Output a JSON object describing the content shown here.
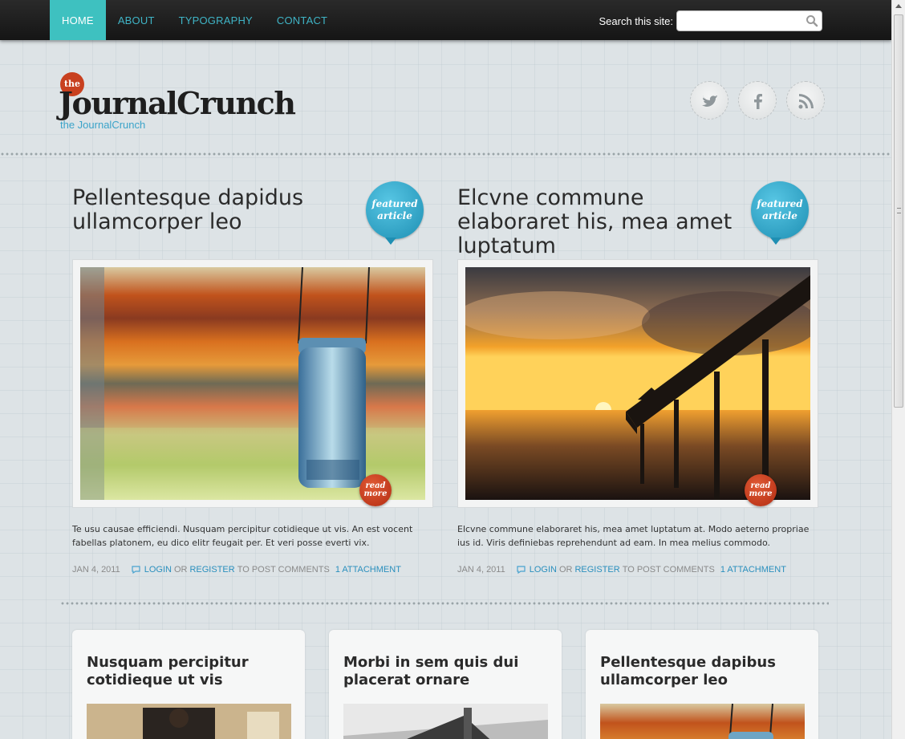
{
  "nav": {
    "items": [
      {
        "label": "HOME",
        "active": true
      },
      {
        "label": "ABOUT"
      },
      {
        "label": "TYPOGRAPHY"
      },
      {
        "label": "CONTACT"
      }
    ],
    "search_label": "Search this site:",
    "search_value": "",
    "search_icon": "magnifier-icon"
  },
  "header": {
    "logo_badge": "the",
    "logo_title": "JournalCrunch",
    "tagline": "the JournalCrunch",
    "social": [
      "twitter-icon",
      "facebook-icon",
      "rss-icon"
    ]
  },
  "featured": [
    {
      "title": "Pellentesque dapidus ullamcorper leo",
      "badge": "featured article",
      "badge_line1": "featured",
      "badge_line2": "article",
      "readmore_line1": "read",
      "readmore_line2": "more",
      "excerpt": "Te usu causae efficiendi. Nusquam percipitur cotidieque ut vis. An est vocent fabellas platonem, eu dico elitr feugait per. Et veri posse everti vix.",
      "date": "JAN 4, 2011",
      "login": "LOGIN",
      "or": "OR",
      "register": "REGISTER",
      "post_comments": "TO POST COMMENTS",
      "attachment": "1 ATTACHMENT"
    },
    {
      "title": "Elcvne commune elaboraret his, mea amet luptatum",
      "badge": "featured article",
      "badge_line1": "featured",
      "badge_line2": "article",
      "readmore_line1": "read",
      "readmore_line2": "more",
      "excerpt": "Elcvne commune elaboraret his, mea amet luptatum at. Modo aeterno propriae ius id. Viris definiebas reprehendunt ad eam. In mea melius commodo.",
      "date": "JAN 4, 2011",
      "login": "LOGIN",
      "or": "OR",
      "register": "REGISTER",
      "post_comments": "TO POST COMMENTS",
      "attachment": "1 ATTACHMENT"
    }
  ],
  "cards": [
    {
      "title": "Nusquam percipitur cotidieque ut vis"
    },
    {
      "title": "Morbi in sem quis dui placerat ornare"
    },
    {
      "title": "Pellentesque dapibus ullamcorper leo"
    }
  ],
  "colors": {
    "nav_active": "#3ec1c0",
    "nav_link": "#3fb4c6",
    "accent_link": "#2a8fbd",
    "badge_blue": "#1e8fb3",
    "readmore_red": "#b32c12"
  }
}
